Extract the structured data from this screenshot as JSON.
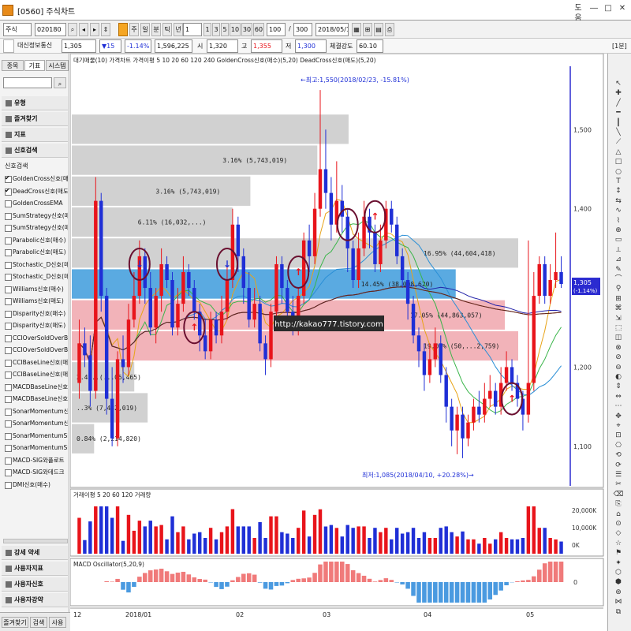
{
  "window": {
    "title": "[0560] 주식차트",
    "buttons": [
      "도움",
      "―",
      "□",
      "✕"
    ]
  },
  "toolbar1": {
    "market": "주식",
    "code": "020180",
    "chart_type_buttons": [
      "주",
      "일",
      "분",
      "틱",
      "년"
    ],
    "period_select": "1",
    "periods": [
      "1",
      "3",
      "5",
      "10",
      "30",
      "60"
    ],
    "count": "100",
    "of": "300",
    "date": "2018/05/13"
  },
  "toolbar2": {
    "name": "대신정보통신",
    "change": "▼15",
    "rate": "-1.14%",
    "volume": "1,596,225",
    "open_label": "시",
    "open": "1,320",
    "high_label": "고",
    "high": "1,355",
    "low_label": "저",
    "low": "1,300",
    "strength_label": "체결강도",
    "strength": "60.10",
    "price": "1,305",
    "right_badge": "[1분]"
  },
  "left_panel": {
    "tabs": [
      "종목",
      "기표",
      "시스템"
    ],
    "sections_top": [
      "유형",
      "즐겨찾기",
      "지표",
      "신호검색"
    ],
    "list_header": "신호검색",
    "signals": [
      {
        "label": "GoldenCross신호(매",
        "checked": true
      },
      {
        "label": "DeadCross신호(매도",
        "checked": true
      },
      {
        "label": "GoldenCrossEMA",
        "checked": false
      },
      {
        "label": "SumStrategy신호(매",
        "checked": false
      },
      {
        "label": "SumStrategy신호(매",
        "checked": false
      },
      {
        "label": "Parabolic신호(매수)",
        "checked": false
      },
      {
        "label": "Parabolic신호(매도)",
        "checked": false
      },
      {
        "label": "Stochastic_D신호(매",
        "checked": false
      },
      {
        "label": "Stochastic_D신호(매",
        "checked": false
      },
      {
        "label": "Williams신호(매수)",
        "checked": false
      },
      {
        "label": "Williams신호(매도)",
        "checked": false
      },
      {
        "label": "Disparity신호(매수)",
        "checked": false
      },
      {
        "label": "Disparity신호(매도)",
        "checked": false
      },
      {
        "label": "CCIOverSoldOverBo",
        "checked": false
      },
      {
        "label": "CCIOverSoldOverBo",
        "checked": false
      },
      {
        "label": "CCIBaseLine신호(매",
        "checked": false
      },
      {
        "label": "CCIBaseLine신호(매",
        "checked": false
      },
      {
        "label": "MACDBaseLine신호",
        "checked": false
      },
      {
        "label": "MACDBaseLine신호",
        "checked": false
      },
      {
        "label": "SonarMomentum신",
        "checked": false
      },
      {
        "label": "SonarMomentum신",
        "checked": false
      },
      {
        "label": "SonarMomentumSig",
        "checked": false
      },
      {
        "label": "SonarMomentumSig",
        "checked": false
      },
      {
        "label": "MACD-SIG와플로트",
        "checked": false
      },
      {
        "label": "MACD-SIG와데드크",
        "checked": false
      },
      {
        "label": "DMI신호(매수)",
        "checked": false
      }
    ],
    "sections_bottom": [
      "강세 약세",
      "사용자지표",
      "사용자신호",
      "사용자강약"
    ],
    "bottom_tabs": [
      "즐겨찾기",
      "검색",
      "사용"
    ]
  },
  "price_panel": {
    "legend_parts": [
      "대기매물(10)",
      "가격차트",
      "가격이평 5",
      "10",
      "20",
      "60",
      "120",
      "240",
      "GoldenCross신호(매수)(5,20)",
      "DeadCross신호(매도)(5,20)"
    ],
    "high_note": "←최고:1,550(2018/02/23, -15.81%)",
    "low_note": "최저:1,085(2018/04/10, +20.28%)→",
    "watermark": "http://kakao777.tistory.com",
    "y_ticks": [
      "1,500",
      "1,400",
      "1,300",
      "1,200",
      "1,100"
    ],
    "current_price": "1,305",
    "current_change": "(-1.14%)",
    "volume_profile": [
      {
        "label": "",
        "pct": 0.62
      },
      {
        "label": "3.16% (5,743,019)",
        "pct": 0.55
      },
      {
        "label": "3.16% (5,743,019)",
        "pct": 0.4
      },
      {
        "label": "6.11% (16,032,...)",
        "pct": 0.36
      },
      {
        "label": "16.95% (44,604,418)",
        "pct": 1.0
      },
      {
        "label": "14.45% (38,008,620)",
        "pct": 0.86
      },
      {
        "label": "17.05% (44,863,057)",
        "pct": 0.97
      },
      {
        "label": "19.01% (50,...2,759)",
        "pct": 1.0
      },
      {
        "label": "2.4...(...05,465)",
        "pct": 0.14
      },
      {
        "label": "..3% (7,432,019)",
        "pct": 0.17
      },
      {
        "label": "0.84% (2,214,820)",
        "pct": 0.05
      }
    ]
  },
  "volume_panel": {
    "legend": "거래이평 5  20  60  120  거래량",
    "y_ticks": [
      "20,000K",
      "10,000K",
      "0K"
    ]
  },
  "macd_panel": {
    "legend": "MACD Oscillator(5,20,9)",
    "y_tick": "0"
  },
  "x_axis": {
    "labels": [
      "12",
      "2018/01",
      "02",
      "03",
      "04",
      "05"
    ]
  },
  "chart_data": {
    "type": "candlestick",
    "title": "",
    "x": [
      "2017-12",
      "2018-01",
      "2018-02",
      "2018-03",
      "2018-04",
      "2018-05"
    ],
    "ylim": [
      1050,
      1580
    ],
    "candles": [
      {
        "o": 1180,
        "c": 1230,
        "h": 1260,
        "l": 1160
      },
      {
        "o": 1230,
        "c": 1215,
        "h": 1250,
        "l": 1200
      },
      {
        "o": 1215,
        "c": 1170,
        "h": 1240,
        "l": 1150
      },
      {
        "o": 1170,
        "c": 1410,
        "h": 1440,
        "l": 1160
      },
      {
        "o": 1410,
        "c": 1290,
        "h": 1420,
        "l": 1270
      },
      {
        "o": 1290,
        "c": 1160,
        "h": 1300,
        "l": 1140
      },
      {
        "o": 1160,
        "c": 1110,
        "h": 1200,
        "l": 1100
      },
      {
        "o": 1110,
        "c": 1210,
        "h": 1220,
        "l": 1100
      },
      {
        "o": 1210,
        "c": 1200,
        "h": 1240,
        "l": 1180
      },
      {
        "o": 1200,
        "c": 1260,
        "h": 1280,
        "l": 1190
      },
      {
        "o": 1260,
        "c": 1290,
        "h": 1320,
        "l": 1250
      },
      {
        "o": 1290,
        "c": 1340,
        "h": 1360,
        "l": 1280
      },
      {
        "o": 1340,
        "c": 1300,
        "h": 1350,
        "l": 1280
      },
      {
        "o": 1300,
        "c": 1250,
        "h": 1320,
        "l": 1240
      },
      {
        "o": 1250,
        "c": 1290,
        "h": 1300,
        "l": 1230
      },
      {
        "o": 1290,
        "c": 1330,
        "h": 1350,
        "l": 1270
      },
      {
        "o": 1330,
        "c": 1310,
        "h": 1340,
        "l": 1300
      },
      {
        "o": 1310,
        "c": 1250,
        "h": 1320,
        "l": 1240
      },
      {
        "o": 1250,
        "c": 1280,
        "h": 1300,
        "l": 1240
      },
      {
        "o": 1280,
        "c": 1320,
        "h": 1340,
        "l": 1270
      },
      {
        "o": 1320,
        "c": 1300,
        "h": 1330,
        "l": 1290
      },
      {
        "o": 1300,
        "c": 1270,
        "h": 1310,
        "l": 1260
      },
      {
        "o": 1270,
        "c": 1240,
        "h": 1280,
        "l": 1220
      },
      {
        "o": 1240,
        "c": 1220,
        "h": 1260,
        "l": 1210
      },
      {
        "o": 1220,
        "c": 1260,
        "h": 1270,
        "l": 1210
      },
      {
        "o": 1260,
        "c": 1240,
        "h": 1270,
        "l": 1230
      },
      {
        "o": 1240,
        "c": 1270,
        "h": 1290,
        "l": 1230
      },
      {
        "o": 1270,
        "c": 1310,
        "h": 1330,
        "l": 1260
      },
      {
        "o": 1310,
        "c": 1380,
        "h": 1400,
        "l": 1300
      },
      {
        "o": 1380,
        "c": 1340,
        "h": 1390,
        "l": 1320
      },
      {
        "o": 1340,
        "c": 1300,
        "h": 1350,
        "l": 1280
      },
      {
        "o": 1300,
        "c": 1260,
        "h": 1320,
        "l": 1250
      },
      {
        "o": 1260,
        "c": 1280,
        "h": 1300,
        "l": 1250
      },
      {
        "o": 1280,
        "c": 1230,
        "h": 1290,
        "l": 1220
      },
      {
        "o": 1230,
        "c": 1210,
        "h": 1240,
        "l": 1190
      },
      {
        "o": 1210,
        "c": 1270,
        "h": 1280,
        "l": 1200
      },
      {
        "o": 1270,
        "c": 1330,
        "h": 1340,
        "l": 1260
      },
      {
        "o": 1330,
        "c": 1300,
        "h": 1340,
        "l": 1280
      },
      {
        "o": 1300,
        "c": 1270,
        "h": 1310,
        "l": 1260
      },
      {
        "o": 1270,
        "c": 1250,
        "h": 1290,
        "l": 1240
      },
      {
        "o": 1250,
        "c": 1290,
        "h": 1300,
        "l": 1240
      },
      {
        "o": 1290,
        "c": 1360,
        "h": 1370,
        "l": 1280
      },
      {
        "o": 1360,
        "c": 1340,
        "h": 1380,
        "l": 1320
      },
      {
        "o": 1340,
        "c": 1400,
        "h": 1420,
        "l": 1330
      },
      {
        "o": 1400,
        "c": 1450,
        "h": 1550,
        "l": 1390
      },
      {
        "o": 1450,
        "c": 1420,
        "h": 1500,
        "l": 1400
      },
      {
        "o": 1420,
        "c": 1380,
        "h": 1440,
        "l": 1360
      },
      {
        "o": 1380,
        "c": 1410,
        "h": 1460,
        "l": 1370
      },
      {
        "o": 1410,
        "c": 1390,
        "h": 1430,
        "l": 1370
      },
      {
        "o": 1390,
        "c": 1350,
        "h": 1400,
        "l": 1320
      },
      {
        "o": 1350,
        "c": 1310,
        "h": 1360,
        "l": 1300
      },
      {
        "o": 1310,
        "c": 1350,
        "h": 1370,
        "l": 1300
      },
      {
        "o": 1350,
        "c": 1390,
        "h": 1410,
        "l": 1340
      },
      {
        "o": 1390,
        "c": 1370,
        "h": 1400,
        "l": 1350
      },
      {
        "o": 1370,
        "c": 1330,
        "h": 1380,
        "l": 1320
      },
      {
        "o": 1330,
        "c": 1360,
        "h": 1380,
        "l": 1320
      },
      {
        "o": 1360,
        "c": 1400,
        "h": 1410,
        "l": 1350
      },
      {
        "o": 1400,
        "c": 1380,
        "h": 1410,
        "l": 1370
      },
      {
        "o": 1380,
        "c": 1340,
        "h": 1390,
        "l": 1330
      },
      {
        "o": 1340,
        "c": 1310,
        "h": 1350,
        "l": 1300
      },
      {
        "o": 1310,
        "c": 1280,
        "h": 1320,
        "l": 1260
      },
      {
        "o": 1280,
        "c": 1240,
        "h": 1290,
        "l": 1230
      },
      {
        "o": 1240,
        "c": 1220,
        "h": 1250,
        "l": 1200
      },
      {
        "o": 1220,
        "c": 1190,
        "h": 1230,
        "l": 1170
      },
      {
        "o": 1190,
        "c": 1210,
        "h": 1230,
        "l": 1180
      },
      {
        "o": 1210,
        "c": 1230,
        "h": 1250,
        "l": 1200
      },
      {
        "o": 1230,
        "c": 1190,
        "h": 1240,
        "l": 1180
      },
      {
        "o": 1190,
        "c": 1150,
        "h": 1200,
        "l": 1130
      },
      {
        "o": 1150,
        "c": 1120,
        "h": 1160,
        "l": 1100
      },
      {
        "o": 1120,
        "c": 1140,
        "h": 1150,
        "l": 1090
      },
      {
        "o": 1140,
        "c": 1110,
        "h": 1150,
        "l": 1085
      },
      {
        "o": 1110,
        "c": 1130,
        "h": 1140,
        "l": 1100
      },
      {
        "o": 1130,
        "c": 1150,
        "h": 1160,
        "l": 1120
      },
      {
        "o": 1150,
        "c": 1140,
        "h": 1170,
        "l": 1130
      },
      {
        "o": 1140,
        "c": 1160,
        "h": 1180,
        "l": 1130
      },
      {
        "o": 1160,
        "c": 1170,
        "h": 1190,
        "l": 1150
      },
      {
        "o": 1170,
        "c": 1150,
        "h": 1180,
        "l": 1140
      },
      {
        "o": 1150,
        "c": 1180,
        "h": 1200,
        "l": 1140
      },
      {
        "o": 1180,
        "c": 1200,
        "h": 1220,
        "l": 1170
      },
      {
        "o": 1200,
        "c": 1180,
        "h": 1210,
        "l": 1170
      },
      {
        "o": 1180,
        "c": 1160,
        "h": 1190,
        "l": 1150
      },
      {
        "o": 1160,
        "c": 1140,
        "h": 1170,
        "l": 1120
      },
      {
        "o": 1140,
        "c": 1180,
        "h": 1360,
        "l": 1130
      },
      {
        "o": 1180,
        "c": 1290,
        "h": 1320,
        "l": 1170
      },
      {
        "o": 1290,
        "c": 1330,
        "h": 1340,
        "l": 1280
      },
      {
        "o": 1330,
        "c": 1290,
        "h": 1340,
        "l": 1280
      },
      {
        "o": 1290,
        "c": 1310,
        "h": 1330,
        "l": 1280
      },
      {
        "o": 1310,
        "c": 1320,
        "h": 1370,
        "l": 1300
      },
      {
        "o": 1320,
        "c": 1305,
        "h": 1340,
        "l": 1300
      }
    ],
    "signals": [
      {
        "index": 11,
        "type": "dead",
        "price": 1330
      },
      {
        "index": 21,
        "type": "golden",
        "price": 1250
      },
      {
        "index": 27,
        "type": "dead",
        "price": 1330
      },
      {
        "index": 40,
        "type": "golden",
        "price": 1320
      },
      {
        "index": 49,
        "type": "dead",
        "price": 1380
      },
      {
        "index": 54,
        "type": "golden",
        "price": 1390
      },
      {
        "index": 79,
        "type": "golden",
        "price": 1160
      }
    ]
  },
  "colors": {
    "up": "#e8141b",
    "down": "#1f2fd6",
    "profile_gray": "#c9c9c9",
    "profile_blue": "#3d9bdc",
    "profile_red": "#f0a6ad",
    "current_line": "#2b2bd0"
  }
}
